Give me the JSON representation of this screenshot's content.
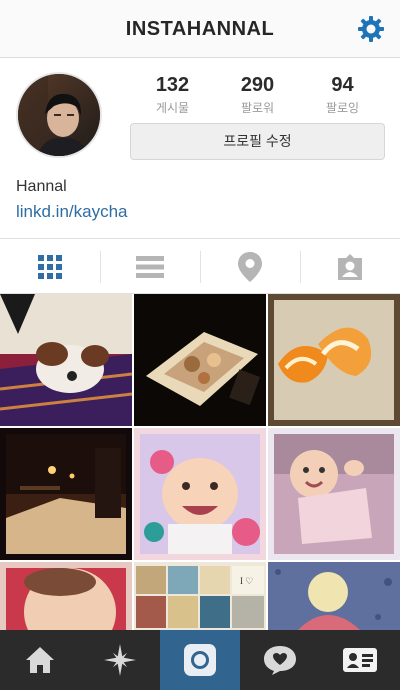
{
  "header": {
    "title": "INSTAHANNAL",
    "settings_icon": "gear-icon",
    "accent": "#1f73b7"
  },
  "profile": {
    "stats": [
      {
        "count": "132",
        "label": "게시물"
      },
      {
        "count": "290",
        "label": "팔로워"
      },
      {
        "count": "94",
        "label": "팔로잉"
      }
    ],
    "edit_button": "프로필 수정",
    "name": "Hannal",
    "website": "linkd.in/kaycha"
  },
  "view_tabs": [
    {
      "icon": "grid-icon",
      "active": true
    },
    {
      "icon": "list-icon",
      "active": false
    },
    {
      "icon": "location-pin-icon",
      "active": false
    },
    {
      "icon": "tagged-photos-icon",
      "active": false
    }
  ],
  "photos": [
    {
      "subject": "dog-on-blanket"
    },
    {
      "subject": "food-platter"
    },
    {
      "subject": "orange-peel"
    },
    {
      "subject": "snowy-night-street"
    },
    {
      "subject": "baby-smiling"
    },
    {
      "subject": "baby-playing"
    },
    {
      "subject": "baby-closeup"
    },
    {
      "subject": "collage"
    },
    {
      "subject": "child-outdoors"
    }
  ],
  "bottom_nav": [
    {
      "icon": "home-icon",
      "active": false
    },
    {
      "icon": "explore-star-icon",
      "active": false
    },
    {
      "icon": "camera-icon",
      "active": true
    },
    {
      "icon": "activity-bubble-icon",
      "active": false
    },
    {
      "icon": "profile-card-icon",
      "active": false
    }
  ],
  "colors": {
    "link": "#2e6da4",
    "nav_bg": "#2b2b2b",
    "nav_active": "#31648e",
    "tab_active": "#2f6fa5",
    "tab_inactive": "#b5b5b5"
  }
}
